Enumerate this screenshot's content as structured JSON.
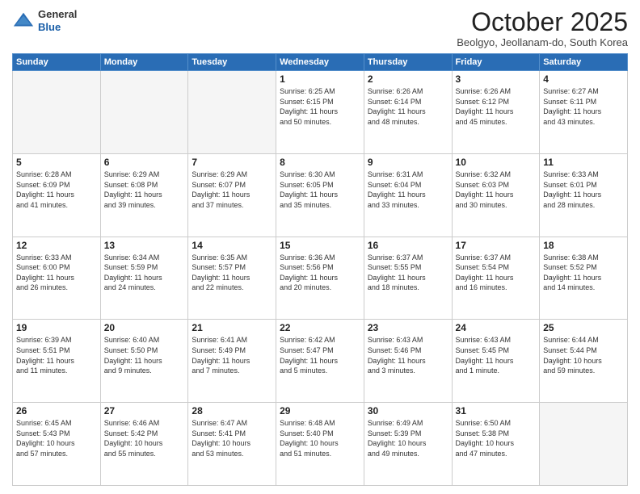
{
  "header": {
    "logo_general": "General",
    "logo_blue": "Blue",
    "month_title": "October 2025",
    "subtitle": "Beolgyo, Jeollanam-do, South Korea"
  },
  "days_of_week": [
    "Sunday",
    "Monday",
    "Tuesday",
    "Wednesday",
    "Thursday",
    "Friday",
    "Saturday"
  ],
  "weeks": [
    [
      {
        "day": "",
        "info": ""
      },
      {
        "day": "",
        "info": ""
      },
      {
        "day": "",
        "info": ""
      },
      {
        "day": "1",
        "info": "Sunrise: 6:25 AM\nSunset: 6:15 PM\nDaylight: 11 hours\nand 50 minutes."
      },
      {
        "day": "2",
        "info": "Sunrise: 6:26 AM\nSunset: 6:14 PM\nDaylight: 11 hours\nand 48 minutes."
      },
      {
        "day": "3",
        "info": "Sunrise: 6:26 AM\nSunset: 6:12 PM\nDaylight: 11 hours\nand 45 minutes."
      },
      {
        "day": "4",
        "info": "Sunrise: 6:27 AM\nSunset: 6:11 PM\nDaylight: 11 hours\nand 43 minutes."
      }
    ],
    [
      {
        "day": "5",
        "info": "Sunrise: 6:28 AM\nSunset: 6:09 PM\nDaylight: 11 hours\nand 41 minutes."
      },
      {
        "day": "6",
        "info": "Sunrise: 6:29 AM\nSunset: 6:08 PM\nDaylight: 11 hours\nand 39 minutes."
      },
      {
        "day": "7",
        "info": "Sunrise: 6:29 AM\nSunset: 6:07 PM\nDaylight: 11 hours\nand 37 minutes."
      },
      {
        "day": "8",
        "info": "Sunrise: 6:30 AM\nSunset: 6:05 PM\nDaylight: 11 hours\nand 35 minutes."
      },
      {
        "day": "9",
        "info": "Sunrise: 6:31 AM\nSunset: 6:04 PM\nDaylight: 11 hours\nand 33 minutes."
      },
      {
        "day": "10",
        "info": "Sunrise: 6:32 AM\nSunset: 6:03 PM\nDaylight: 11 hours\nand 30 minutes."
      },
      {
        "day": "11",
        "info": "Sunrise: 6:33 AM\nSunset: 6:01 PM\nDaylight: 11 hours\nand 28 minutes."
      }
    ],
    [
      {
        "day": "12",
        "info": "Sunrise: 6:33 AM\nSunset: 6:00 PM\nDaylight: 11 hours\nand 26 minutes."
      },
      {
        "day": "13",
        "info": "Sunrise: 6:34 AM\nSunset: 5:59 PM\nDaylight: 11 hours\nand 24 minutes."
      },
      {
        "day": "14",
        "info": "Sunrise: 6:35 AM\nSunset: 5:57 PM\nDaylight: 11 hours\nand 22 minutes."
      },
      {
        "day": "15",
        "info": "Sunrise: 6:36 AM\nSunset: 5:56 PM\nDaylight: 11 hours\nand 20 minutes."
      },
      {
        "day": "16",
        "info": "Sunrise: 6:37 AM\nSunset: 5:55 PM\nDaylight: 11 hours\nand 18 minutes."
      },
      {
        "day": "17",
        "info": "Sunrise: 6:37 AM\nSunset: 5:54 PM\nDaylight: 11 hours\nand 16 minutes."
      },
      {
        "day": "18",
        "info": "Sunrise: 6:38 AM\nSunset: 5:52 PM\nDaylight: 11 hours\nand 14 minutes."
      }
    ],
    [
      {
        "day": "19",
        "info": "Sunrise: 6:39 AM\nSunset: 5:51 PM\nDaylight: 11 hours\nand 11 minutes."
      },
      {
        "day": "20",
        "info": "Sunrise: 6:40 AM\nSunset: 5:50 PM\nDaylight: 11 hours\nand 9 minutes."
      },
      {
        "day": "21",
        "info": "Sunrise: 6:41 AM\nSunset: 5:49 PM\nDaylight: 11 hours\nand 7 minutes."
      },
      {
        "day": "22",
        "info": "Sunrise: 6:42 AM\nSunset: 5:47 PM\nDaylight: 11 hours\nand 5 minutes."
      },
      {
        "day": "23",
        "info": "Sunrise: 6:43 AM\nSunset: 5:46 PM\nDaylight: 11 hours\nand 3 minutes."
      },
      {
        "day": "24",
        "info": "Sunrise: 6:43 AM\nSunset: 5:45 PM\nDaylight: 11 hours\nand 1 minute."
      },
      {
        "day": "25",
        "info": "Sunrise: 6:44 AM\nSunset: 5:44 PM\nDaylight: 10 hours\nand 59 minutes."
      }
    ],
    [
      {
        "day": "26",
        "info": "Sunrise: 6:45 AM\nSunset: 5:43 PM\nDaylight: 10 hours\nand 57 minutes."
      },
      {
        "day": "27",
        "info": "Sunrise: 6:46 AM\nSunset: 5:42 PM\nDaylight: 10 hours\nand 55 minutes."
      },
      {
        "day": "28",
        "info": "Sunrise: 6:47 AM\nSunset: 5:41 PM\nDaylight: 10 hours\nand 53 minutes."
      },
      {
        "day": "29",
        "info": "Sunrise: 6:48 AM\nSunset: 5:40 PM\nDaylight: 10 hours\nand 51 minutes."
      },
      {
        "day": "30",
        "info": "Sunrise: 6:49 AM\nSunset: 5:39 PM\nDaylight: 10 hours\nand 49 minutes."
      },
      {
        "day": "31",
        "info": "Sunrise: 6:50 AM\nSunset: 5:38 PM\nDaylight: 10 hours\nand 47 minutes."
      },
      {
        "day": "",
        "info": ""
      }
    ]
  ]
}
